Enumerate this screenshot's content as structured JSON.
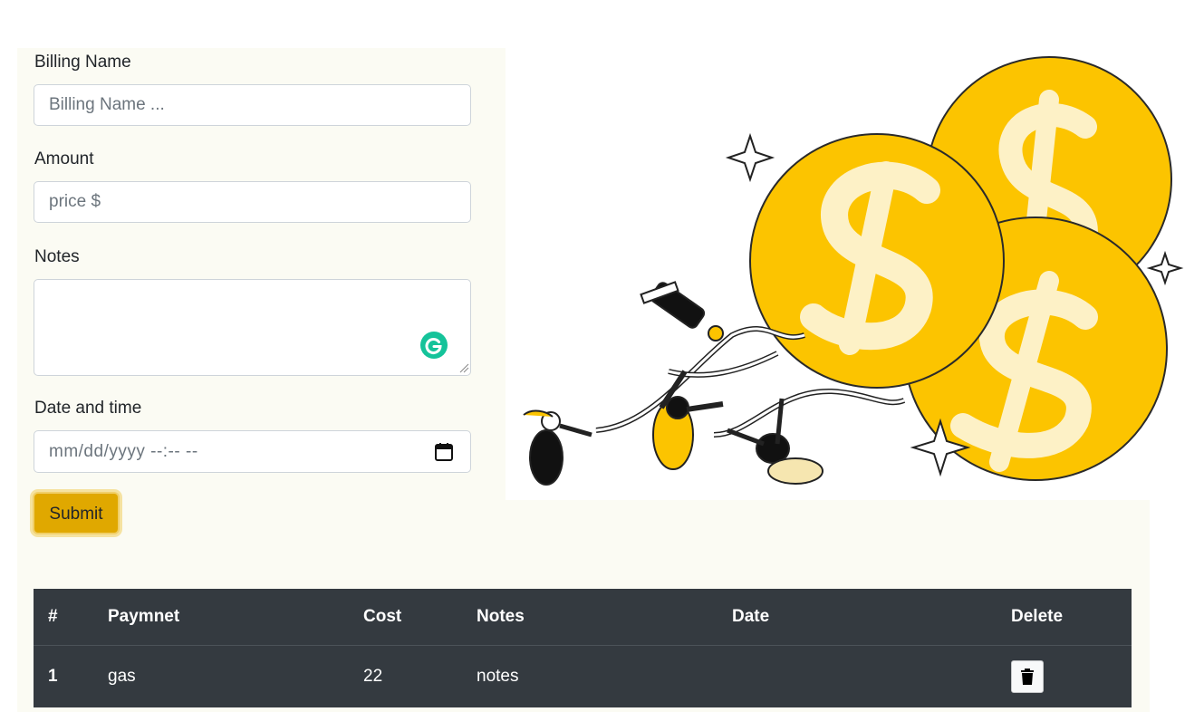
{
  "form": {
    "billing_name_label": "Billing Name",
    "billing_name_placeholder": "Billing Name ...",
    "amount_label": "Amount",
    "amount_placeholder": "price $",
    "notes_label": "Notes",
    "date_label": "Date and time",
    "date_placeholder": "mm/dd/yyyy --:-- --",
    "submit_label": "Submit"
  },
  "table": {
    "headers": [
      "#",
      "Paymnet",
      "Cost",
      "Notes",
      "Date",
      "Delete"
    ],
    "rows": [
      {
        "num": "1",
        "payment": "gas",
        "cost": "22",
        "notes": "notes",
        "date": ""
      }
    ]
  },
  "colors": {
    "panel_bg": "#fbfbf3",
    "accent": "#e0a800",
    "table_bg": "#343a40",
    "coin": "#fcc400",
    "coin_symbol": "#fdf1c6"
  },
  "icons": {
    "calendar": "calendar-icon",
    "trash": "trash-icon",
    "grammarly": "grammarly-icon"
  }
}
